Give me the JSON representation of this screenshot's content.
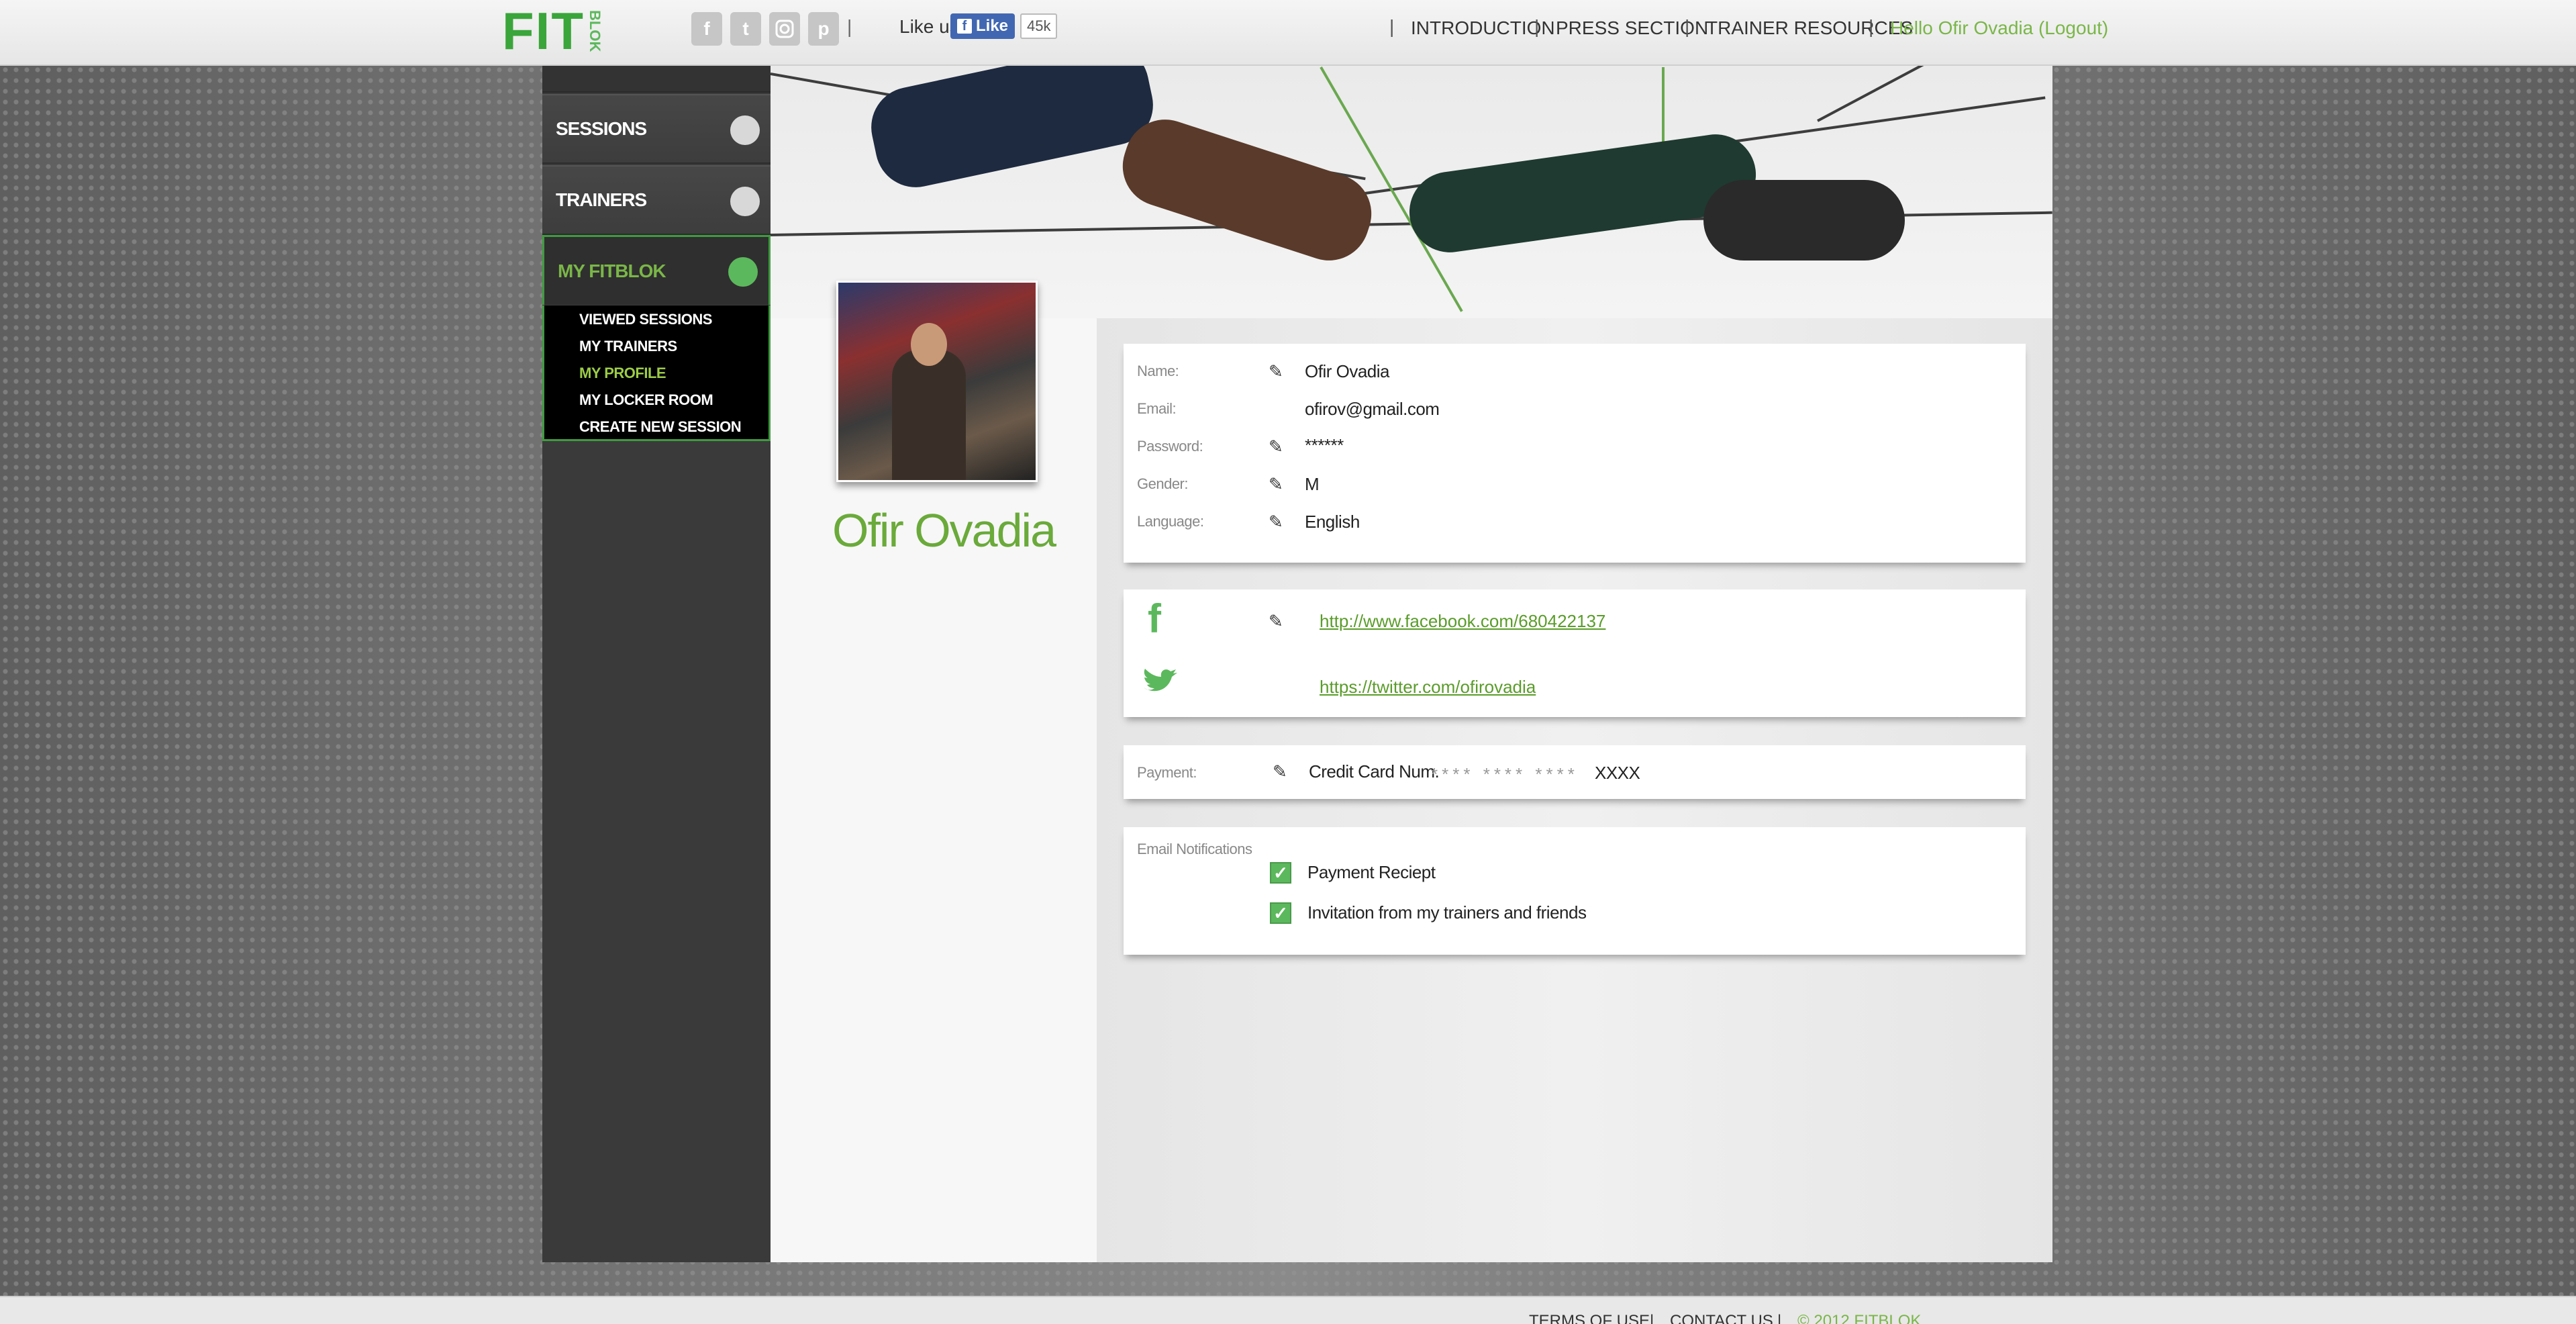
{
  "header": {
    "logo_main": "FIT",
    "logo_side": "BLOK",
    "social_icons": [
      "facebook-icon",
      "twitter-icon",
      "instagram-icon",
      "pinterest-icon"
    ],
    "like_label": "Like us",
    "fb_like_label": "Like",
    "fb_count": "45k",
    "nav": [
      "INTRODUCTION",
      "PRESS SECTION",
      "TRAINER RESOURCES"
    ],
    "greeting": "Hello Ofir Ovadia (Logout)"
  },
  "sidebar": {
    "items": [
      {
        "label": "SESSIONS"
      },
      {
        "label": "TRAINERS"
      },
      {
        "label": "MY FITBLOK"
      }
    ],
    "submenu": [
      "VIEWED SESSIONS",
      "MY TRAINERS",
      "MY PROFILE",
      "MY LOCKER ROOM",
      "CREATE NEW SESSION"
    ],
    "active_submenu": "MY PROFILE"
  },
  "profile": {
    "display_name": "Ofir Ovadia",
    "fields": {
      "name_label": "Name:",
      "name_value": "Ofir Ovadia",
      "email_label": "Email:",
      "email_value": "ofirov@gmail.com",
      "password_label": "Password:",
      "password_value": "******",
      "gender_label": "Gender:",
      "gender_value": "M",
      "language_label": "Language:",
      "language_value": "English"
    },
    "social": {
      "facebook_url": "http://www.facebook.com/680422137",
      "twitter_url": "https://twitter.com/ofirovadia"
    },
    "payment": {
      "label": "Payment:",
      "card_label": "Credit Card Num.",
      "masked_groups": "**** **** ****",
      "last_digits": "XXXX"
    },
    "notifications": {
      "label": "Email Notifications",
      "items": [
        {
          "label": "Payment Reciept",
          "checked": true
        },
        {
          "label": "Invitation from my trainers and friends",
          "checked": true
        }
      ]
    }
  },
  "footer": {
    "links": [
      "TERMS OF USE",
      "CONTACT US",
      "© 2012 FITBLOK"
    ]
  },
  "colors": {
    "accent_green": "#7ab648",
    "sidebar_bg": "#3a3a3a",
    "fb_blue": "#4267b2"
  }
}
